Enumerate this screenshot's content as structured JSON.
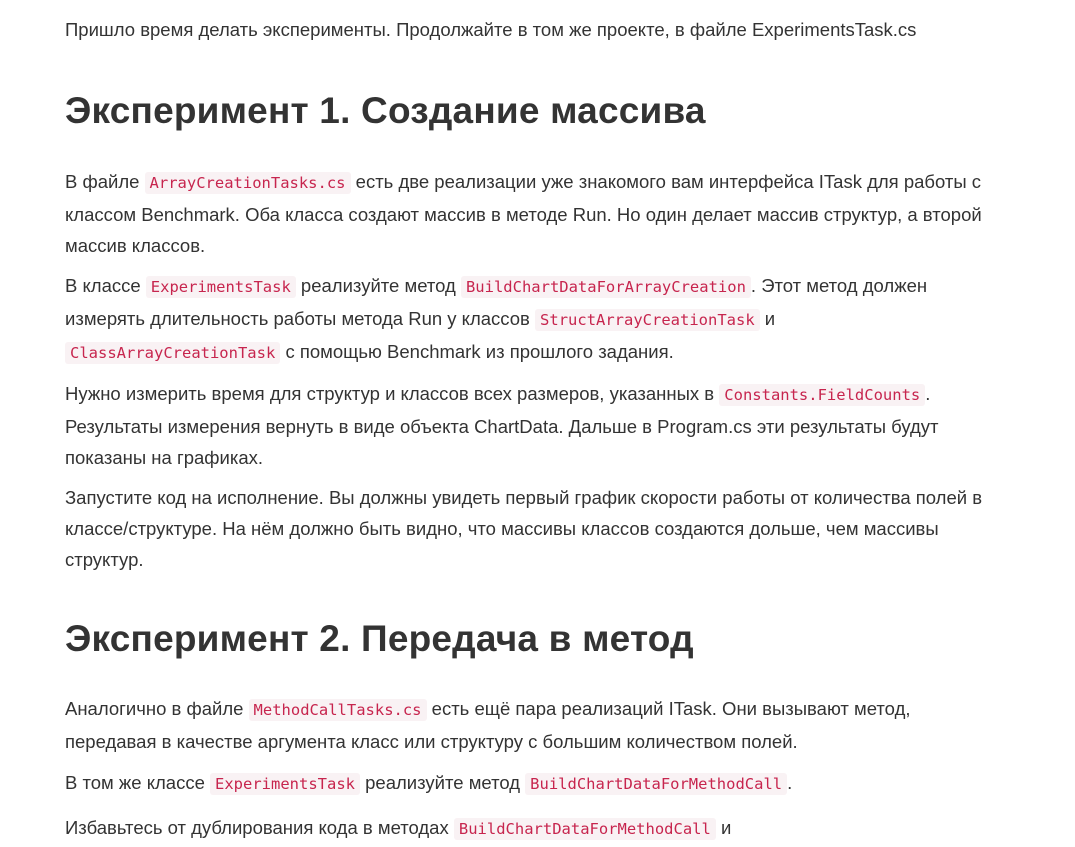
{
  "intro": {
    "text": "Пришло время делать эксперименты. Продолжайте в том же проекте, в файле ExperimentsTask.cs"
  },
  "experiment1": {
    "heading": "Эксперимент 1. Создание массива",
    "p1": {
      "t1": "В файле ",
      "c1": "ArrayCreationTasks.cs",
      "t2": " есть две реализации уже знакомого вам интерфейса ITask для работы с классом Benchmark. Оба класса создают массив в методе Run. Но один делает массив структур, а второй массив классов."
    },
    "p2": {
      "t1": "В классе ",
      "c1": "ExperimentsTask",
      "t2": " реализуйте метод ",
      "c2": "BuildChartDataForArrayCreation",
      "t3": ". Этот метод должен измерять длительность работы метода Run у классов ",
      "c3": "StructArrayCreationTask",
      "t4": " и ",
      "c4": "ClassArrayCreationTask",
      "t5": " с помощью Benchmark из прошлого задания."
    },
    "p3": {
      "t1": "Нужно измерить время для структур и классов всех размеров, указанных в ",
      "c1": "Constants.FieldCounts",
      "t2": ". Результаты измерения вернуть в виде объекта ChartData. Дальше в Program.cs эти результаты будут показаны на графиках."
    },
    "p4": {
      "text": "Запустите код на исполнение. Вы должны увидеть первый график скорости работы от количества полей в классе/структуре. На нём должно быть видно, что массивы классов создаются дольше, чем массивы структур."
    }
  },
  "experiment2": {
    "heading": "Эксперимент 2. Передача в метод",
    "p5": {
      "t1": "Аналогично в файле ",
      "c1": "MethodCallTasks.cs",
      "t2": " есть ещё пара реализаций ITask. Они вызывают метод, передавая в качестве аргумента класс или структуру с большим количеством полей."
    },
    "p6": {
      "t1": "В том же классе ",
      "c1": "ExperimentsTask",
      "t2": " реализуйте метод ",
      "c2": "BuildChartDataForMethodCall",
      "t3": "."
    },
    "p7": {
      "t1": "Избавьтесь от дублирования кода в методах ",
      "c1": "BuildChartDataForMethodCall",
      "t2": " и"
    }
  },
  "colors": {
    "text": "#333333",
    "code_text": "#c7254e",
    "code_background": "#f9f2f4",
    "background": "#ffffff"
  }
}
